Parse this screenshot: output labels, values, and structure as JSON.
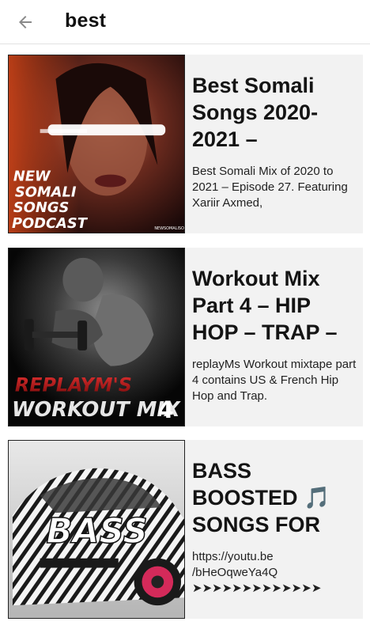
{
  "header": {
    "title": "best",
    "back_icon": "arrow-left-icon"
  },
  "results": [
    {
      "title": "Best Somali Songs 2020-2021 –",
      "description": "Best Somali Mix of 2020 to 2021 – Episode 27. Featuring Xariir Axmed,",
      "thumbnail_text": "NEW SOMALI SONGS PODCAST"
    },
    {
      "title": "Workout Mix Part 4 – HIP HOP – TRAP –",
      "description": "replayMs Workout mixtape part 4 contains US & French Hip Hop and Trap.",
      "thumbnail_text": "REPLAYM'S WORKOUT MIX 4"
    },
    {
      "title": "BASS BOOSTED 🎵 SONGS FOR",
      "description": "https://youtu.be /bHeOqweYa4Q ➤➤➤➤➤➤➤➤➤➤➤➤➤",
      "thumbnail_text": "BASS"
    }
  ],
  "colors": {
    "card_bg": "#f2f2f2",
    "title": "#141414",
    "accent_red": "#c8182a"
  }
}
